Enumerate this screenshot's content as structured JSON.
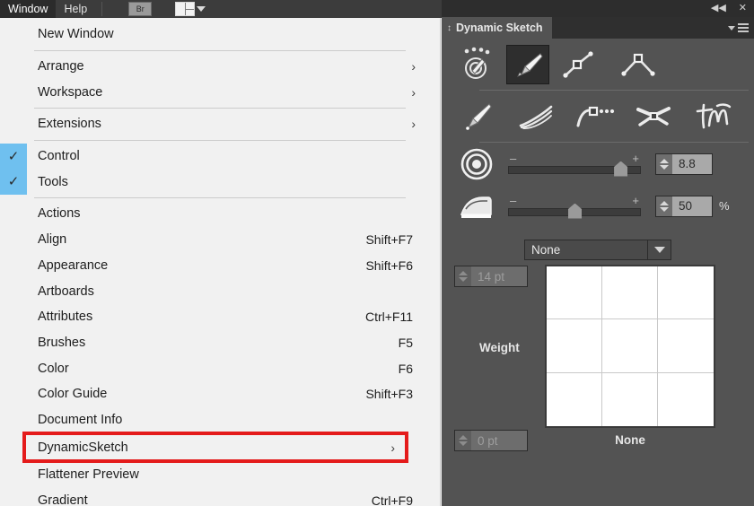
{
  "menubar": {
    "items": [
      {
        "label": "Window",
        "active": true
      },
      {
        "label": "Help",
        "active": false
      }
    ],
    "bridge_button": "Br",
    "arrange_documents_icon": "arrange-documents-icon"
  },
  "menu": {
    "groups": [
      {
        "items": [
          {
            "label": "New Window",
            "shortcut": "",
            "checked": false,
            "submenu": false,
            "highlighted": false
          }
        ]
      },
      {
        "items": [
          {
            "label": "Arrange",
            "shortcut": "",
            "checked": false,
            "submenu": true,
            "highlighted": false
          },
          {
            "label": "Workspace",
            "shortcut": "",
            "checked": false,
            "submenu": true,
            "highlighted": false
          }
        ]
      },
      {
        "items": [
          {
            "label": "Extensions",
            "shortcut": "",
            "checked": false,
            "submenu": true,
            "highlighted": false
          }
        ]
      },
      {
        "items": [
          {
            "label": "Control",
            "shortcut": "",
            "checked": true,
            "submenu": false,
            "highlighted": false
          },
          {
            "label": "Tools",
            "shortcut": "",
            "checked": true,
            "submenu": false,
            "highlighted": false
          }
        ]
      },
      {
        "items": [
          {
            "label": "Actions",
            "shortcut": "",
            "checked": false,
            "submenu": false,
            "highlighted": false
          },
          {
            "label": "Align",
            "shortcut": "Shift+F7",
            "checked": false,
            "submenu": false,
            "highlighted": false
          },
          {
            "label": "Appearance",
            "shortcut": "Shift+F6",
            "checked": false,
            "submenu": false,
            "highlighted": false
          },
          {
            "label": "Artboards",
            "shortcut": "",
            "checked": false,
            "submenu": false,
            "highlighted": false
          },
          {
            "label": "Attributes",
            "shortcut": "Ctrl+F11",
            "checked": false,
            "submenu": false,
            "highlighted": false
          },
          {
            "label": "Brushes",
            "shortcut": "F5",
            "checked": false,
            "submenu": false,
            "highlighted": false
          },
          {
            "label": "Color",
            "shortcut": "F6",
            "checked": false,
            "submenu": false,
            "highlighted": false
          },
          {
            "label": "Color Guide",
            "shortcut": "Shift+F3",
            "checked": false,
            "submenu": false,
            "highlighted": false
          },
          {
            "label": "Document Info",
            "shortcut": "",
            "checked": false,
            "submenu": false,
            "highlighted": false
          },
          {
            "label": "DynamicSketch",
            "shortcut": "",
            "checked": false,
            "submenu": true,
            "highlighted": true
          },
          {
            "label": "Flattener Preview",
            "shortcut": "",
            "checked": false,
            "submenu": false,
            "highlighted": false
          },
          {
            "label": "Gradient",
            "shortcut": "Ctrl+F9",
            "checked": false,
            "submenu": false,
            "highlighted": false
          }
        ]
      }
    ],
    "highlight_color": "#e41b1b",
    "check_highlight_color": "#6fc0ef"
  },
  "panel": {
    "title": "Dynamic Sketch",
    "topbar": {
      "collapse_icon": "◀◀",
      "close_icon": "✕"
    },
    "tools_row1": [
      {
        "name": "target-sketch-tool",
        "selected": false
      },
      {
        "name": "pen-tool",
        "selected": true
      },
      {
        "name": "anchor-point-path-tool",
        "selected": false
      },
      {
        "name": "corner-point-tool",
        "selected": false
      }
    ],
    "tools_row2": [
      {
        "name": "draw-pen-tool",
        "selected": false
      },
      {
        "name": "multi-stroke-tool",
        "selected": false
      },
      {
        "name": "dotted-path-tool",
        "selected": false
      },
      {
        "name": "width-scissors-tool",
        "selected": false
      },
      {
        "name": "scribble-tool",
        "selected": false
      }
    ],
    "sliders": [
      {
        "icon": "target-radius-icon",
        "minus": "–",
        "plus": "+",
        "percent_position": 85,
        "value": "8.8",
        "unit": ""
      },
      {
        "icon": "smoothing-iron-icon",
        "minus": "–",
        "plus": "+",
        "percent_position": 50,
        "value": "50",
        "unit": "%"
      }
    ],
    "style_select": {
      "value": "None",
      "arrow_icon": "chevron-down-icon"
    },
    "weight": {
      "max_value": "14 pt",
      "min_value": "0 pt",
      "label": "Weight",
      "preview_caption": "None"
    }
  }
}
